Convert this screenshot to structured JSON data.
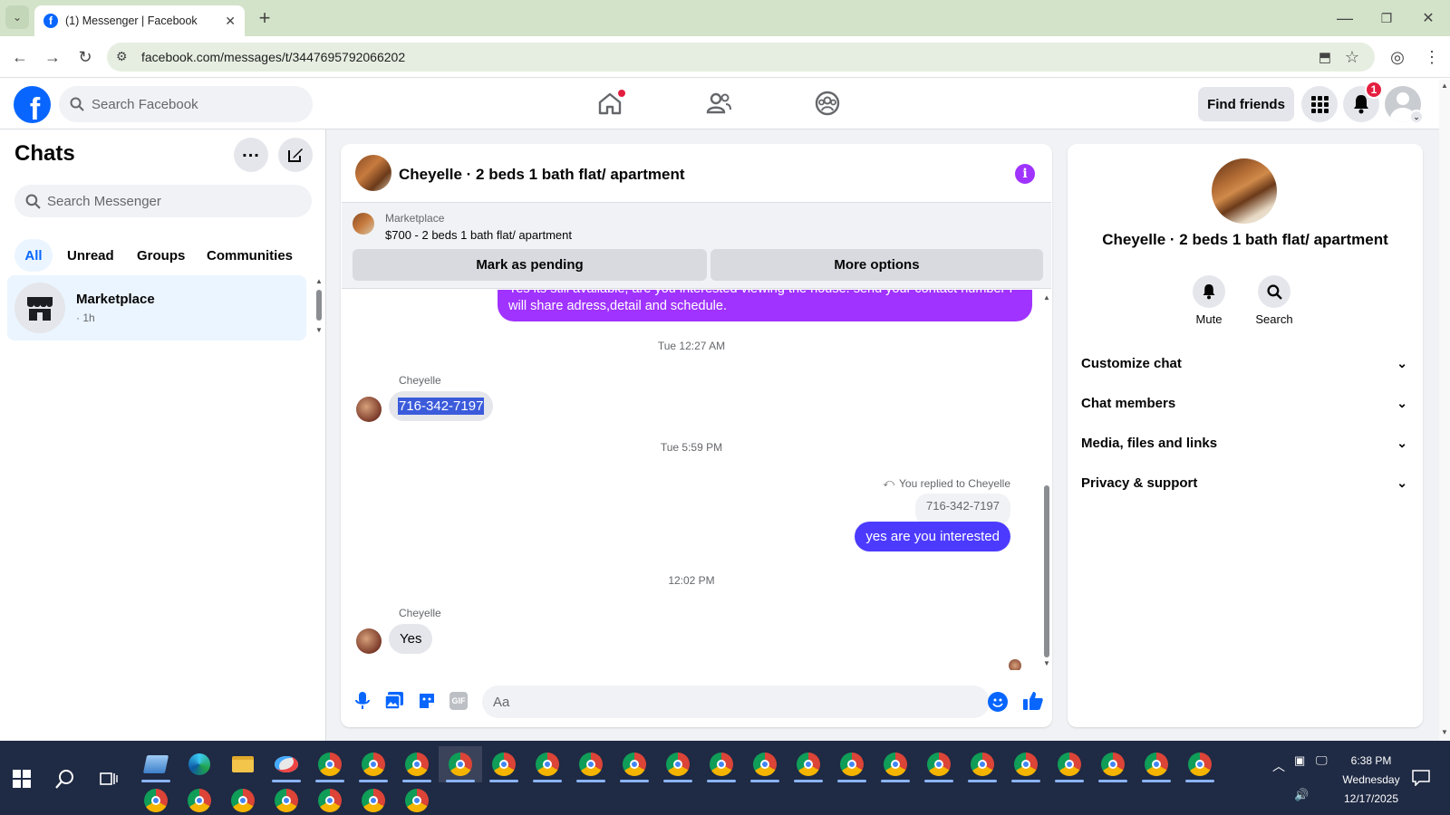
{
  "browser": {
    "tab_title": "(1) Messenger | Facebook",
    "url": "facebook.com/messages/t/3447695792066202",
    "new_tab_icon": "plus-icon"
  },
  "fb": {
    "search_placeholder": "Search Facebook",
    "find_friends": "Find friends",
    "notification_count": "1"
  },
  "chats": {
    "title": "Chats",
    "search_placeholder": "Search Messenger",
    "filters": [
      "All",
      "Unread",
      "Groups",
      "Communities"
    ],
    "conversation": {
      "name": "Marketplace",
      "time": "· 1h"
    }
  },
  "thread": {
    "title": "Cheyelle · 2 beds 1 bath flat/ apartment",
    "listing_source": "Marketplace",
    "listing_title": "$700 - 2 beds 1 bath flat/ apartment",
    "mark_pending": "Mark as pending",
    "more_options": "More options",
    "top_message_line1": "Yes its still available, are you interested viewing the house. send your contact number I",
    "top_message_line2": "will share adress,detail and schedule.",
    "ts1": "Tue 12:27 AM",
    "sender1": "Cheyelle",
    "msg_phone": "716-342-7197",
    "ts2": "Tue 5:59 PM",
    "replied_label": "You replied to Cheyelle",
    "quoted": "716-342-7197",
    "my_reply": "yes are you interested",
    "ts3": "12:02 PM",
    "sender2": "Cheyelle",
    "msg_yes": "Yes",
    "composer_placeholder": "Aa"
  },
  "info": {
    "title": "Cheyelle · 2 beds 1 bath flat/ apartment",
    "mute": "Mute",
    "search": "Search",
    "sections": [
      "Customize chat",
      "Chat members",
      "Media, files and links",
      "Privacy & support"
    ]
  },
  "taskbar": {
    "time": "6:38 PM",
    "day": "Wednesday",
    "date": "12/17/2025"
  },
  "colors": {
    "fb_blue": "#0866ff",
    "messenger_purple": "#a033ff",
    "my_bubble": "#4c3bff",
    "selection": "#3b5bdb"
  }
}
